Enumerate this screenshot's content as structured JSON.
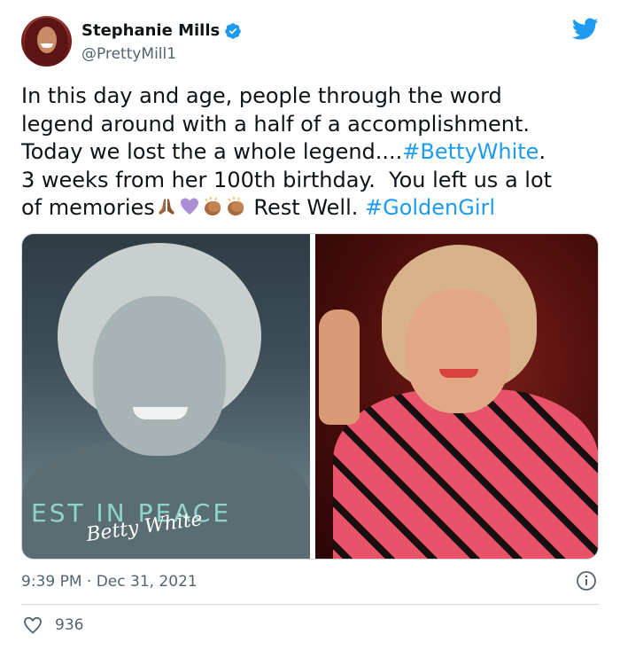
{
  "author": {
    "display_name": "Stephanie Mills",
    "handle": "@PrettyMill1",
    "verified": true
  },
  "tweet": {
    "line1": "In this day and age, people through the word",
    "line2": "legend around with a half of a accomplishment.",
    "line3_text": "Today we lost the a whole legend....",
    "line3_hashtag": "#BettyWhite",
    "line3_end": ".",
    "line4": "3 weeks from her 100th birthday.  You left us a lot",
    "line5_text": "of memories",
    "line5_mid": " Rest Well. ",
    "line5_hashtag": "#GoldenGirl",
    "emojis": [
      "praying-hands-emoji",
      "purple-heart-emoji",
      "clapping-hands-emoji",
      "clapping-hands-emoji"
    ]
  },
  "media": {
    "left_image_caption": "EST IN PEACE",
    "left_image_signature": "Betty White"
  },
  "footer": {
    "timestamp": "9:39 PM · Dec 31, 2021",
    "like_count": "936"
  },
  "colors": {
    "hashtag": "#1d9bf0",
    "verified": "#1d9bf0",
    "secondary_text": "#536471",
    "twitter_brand": "#1d9bf0"
  },
  "icons": [
    "verified-badge-icon",
    "twitter-bird-icon",
    "info-icon",
    "heart-icon"
  ]
}
